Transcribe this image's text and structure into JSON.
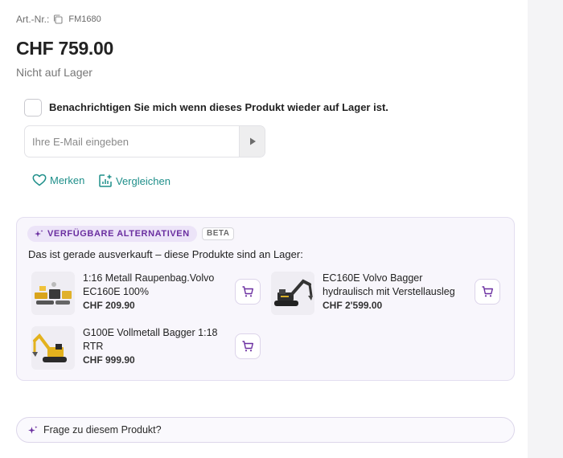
{
  "product": {
    "art_label": "Art.-Nr.:",
    "art_number": "FM1680",
    "price": "CHF 759.00",
    "stock_status": "Nicht auf Lager"
  },
  "notify": {
    "checkbox_label": "Benachrichtigen Sie mich wenn dieses Produkt wieder auf Lager ist.",
    "checked": false,
    "email_placeholder": "Ihre E-Mail eingeben",
    "email_value": ""
  },
  "actions": {
    "merken": "Merken",
    "vergleichen": "Vergleichen"
  },
  "alternatives": {
    "chip_label": "VERFÜGBARE ALTERNATIVEN",
    "badge": "BETA",
    "description": "Das ist gerade ausverkauft – diese Produkte sind an Lager:",
    "items": [
      {
        "name": "1:16 Metall Raupenbag.Volvo EC160E 100%",
        "price": "CHF 209.90",
        "image_icon": "excavator-kit-image",
        "cart_icon": "shopping-cart-icon"
      },
      {
        "name": "EC160E Volvo Bagger hydraulisch mit Verstellausleg",
        "price": "CHF 2'599.00",
        "image_icon": "excavator-black-image",
        "cart_icon": "shopping-cart-icon"
      },
      {
        "name": "G100E Vollmetall Bagger 1:18 RTR",
        "price": "CHF 999.90",
        "image_icon": "excavator-yellow-image",
        "cart_icon": "shopping-cart-icon"
      }
    ]
  },
  "ask": {
    "label": "Frage zu diesem Produkt?"
  },
  "colors": {
    "accent_teal": "#1f8f8a",
    "accent_purple": "#6a2ea0",
    "panel_bg": "#f8f6fc"
  }
}
